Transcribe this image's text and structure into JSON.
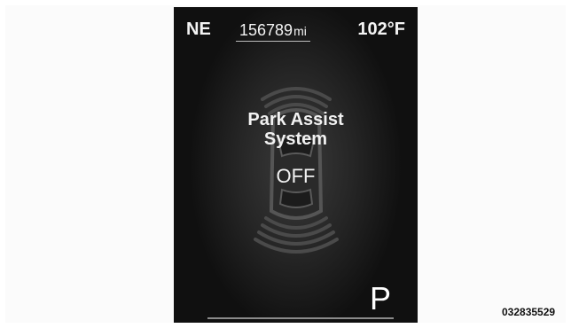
{
  "cluster": {
    "compass_heading": "NE",
    "odometer": {
      "value": "156789",
      "unit": "mi"
    },
    "outside_temperature": "102°F",
    "message": {
      "title_line1": "Park Assist",
      "title_line2": "System",
      "status": "OFF"
    },
    "gear": "P"
  },
  "figure_code": "032835529",
  "icons": {
    "vehicle": "car-top-view-icon",
    "sensors": "park-sensor-arcs-icon"
  }
}
